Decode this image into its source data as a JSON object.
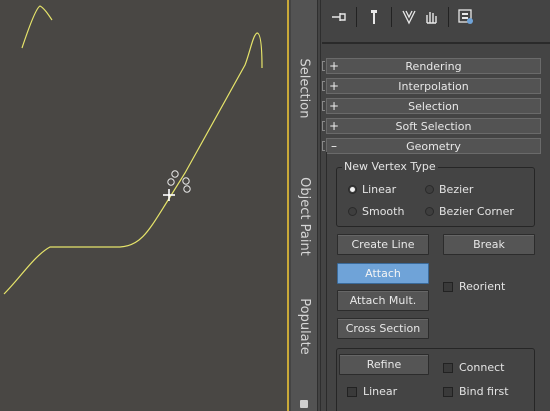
{
  "viewport": {
    "curve_color": "#e6e46a",
    "accent_border": "#c9a938"
  },
  "ribbon": {
    "tabs": [
      "Selection",
      "Object Paint",
      "Populate"
    ]
  },
  "toolbar": {
    "icons": [
      "pin-stack-icon",
      "modifier-stack-icon",
      "show-end-result-icon",
      "make-unique-icon",
      "configure-modifier-sets-icon"
    ]
  },
  "rollouts": {
    "rendering": {
      "sign": "+",
      "label": "Rendering"
    },
    "interpolation": {
      "sign": "+",
      "label": "Interpolation"
    },
    "selection": {
      "sign": "+",
      "label": "Selection"
    },
    "soft_selection": {
      "sign": "+",
      "label": "Soft Selection"
    },
    "geometry": {
      "sign": "–",
      "label": "Geometry"
    }
  },
  "geometry": {
    "new_vertex_type": {
      "title": "New Vertex Type",
      "linear": "Linear",
      "bezier": "Bezier",
      "smooth": "Smooth",
      "bezier_corner": "Bezier Corner",
      "selected": "Linear"
    },
    "create_line": "Create Line",
    "break": "Break",
    "attach": "Attach",
    "reorient": "Reorient",
    "attach_mult": "Attach Mult.",
    "cross_section": "Cross Section",
    "refine": "Refine",
    "connect": "Connect",
    "linear": "Linear",
    "bind_first": "Bind first"
  },
  "colors": {
    "active_button": "#6fa3d8",
    "panel_bg": "#444444"
  }
}
